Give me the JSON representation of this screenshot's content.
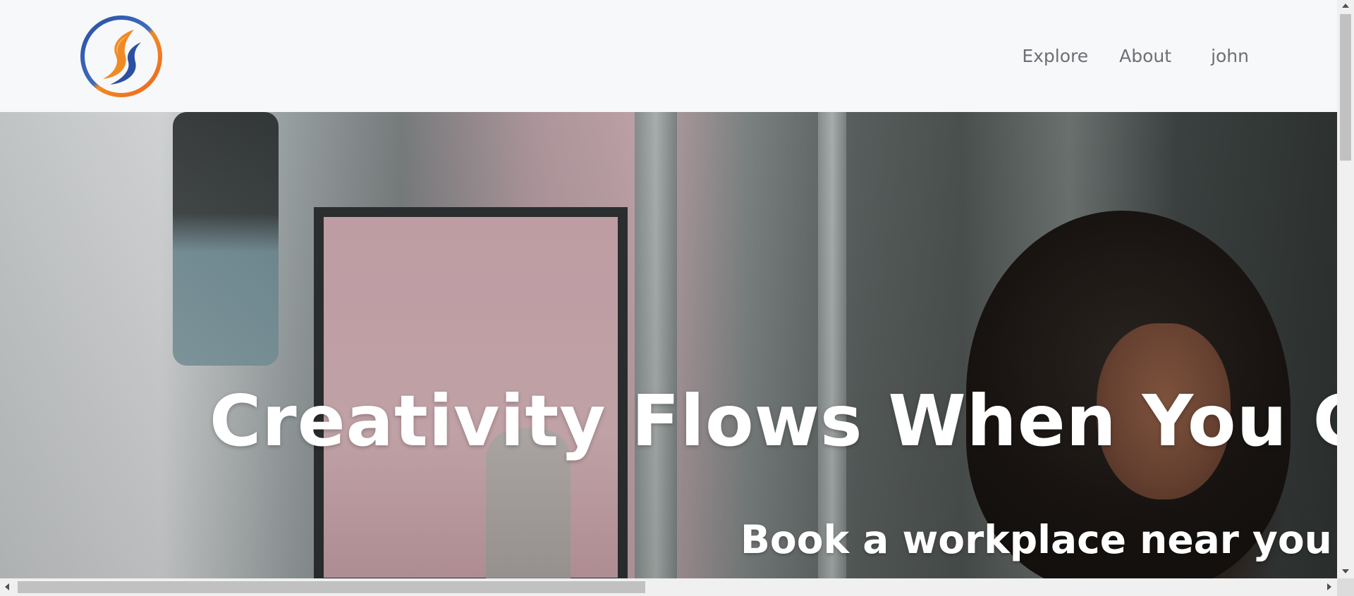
{
  "navbar": {
    "logo_icon": "brand-logo-flame-circle",
    "links": [
      {
        "label": "Explore"
      },
      {
        "label": "About"
      },
      {
        "label": "john"
      }
    ]
  },
  "hero": {
    "headline": "Creativity Flows When You Cha",
    "subheadline": "Book a workplace near you"
  },
  "colors": {
    "nav_text": "#6c6f73",
    "hero_text": "#ffffff",
    "logo_blue": "#2b4fa3",
    "logo_orange": "#f08a24"
  }
}
